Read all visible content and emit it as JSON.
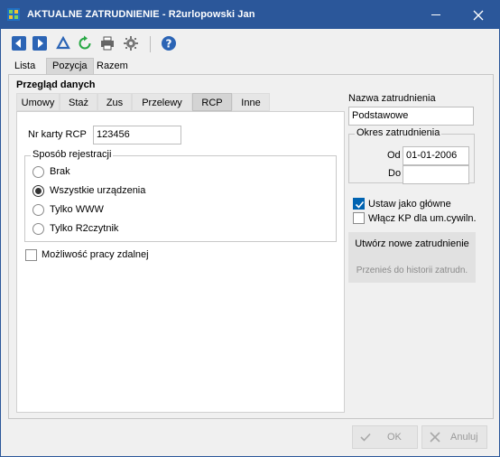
{
  "window": {
    "title": "AKTUALNE ZATRUDNIENIE - R2urlopowski Jan",
    "titlebar_color": "#2b579a"
  },
  "toolbar": {
    "icons": [
      "back-icon",
      "forward-icon",
      "delta-icon",
      "refresh-icon",
      "print-icon",
      "settings-icon",
      "help-icon"
    ]
  },
  "top_tabs": [
    {
      "label": "Lista"
    },
    {
      "label": "Pozycja"
    },
    {
      "label": "Razem"
    }
  ],
  "panel": {
    "title": "Przegląd danych"
  },
  "sub_tabs": [
    {
      "label": "Umowy"
    },
    {
      "label": "Staż"
    },
    {
      "label": "Zus"
    },
    {
      "label": "Przelewy"
    },
    {
      "label": "RCP"
    },
    {
      "label": "Inne"
    }
  ],
  "rcp": {
    "card_label": "Nr karty RCP",
    "card_value": "123456",
    "registration_title": "Sposób rejestracji",
    "options": [
      {
        "label": "Brak",
        "checked": false
      },
      {
        "label": "Wszystkie urządzenia",
        "checked": true
      },
      {
        "label": "Tylko WWW",
        "checked": false
      },
      {
        "label": "Tylko R2czytnik",
        "checked": false
      }
    ],
    "remote_label": "Możliwość pracy zdalnej",
    "remote_checked": false
  },
  "employment": {
    "name_label": "Nazwa zatrudnienia",
    "name_value": "Podstawowe",
    "period_title": "Okres zatrudnienia",
    "from_label": "Od",
    "from_value": "01-01-2006",
    "to_label": "Do",
    "to_value": "",
    "set_main_label": "Ustaw jako główne",
    "set_main_checked": true,
    "kp_label": "Włącz KP dla um.cywiln.",
    "kp_checked": false,
    "create_new_label": "Utwórz nowe zatrudnienie",
    "move_history_label": "Przenieś do historii zatrudn."
  },
  "footer": {
    "ok_label": "OK",
    "cancel_label": "Anuluj"
  }
}
